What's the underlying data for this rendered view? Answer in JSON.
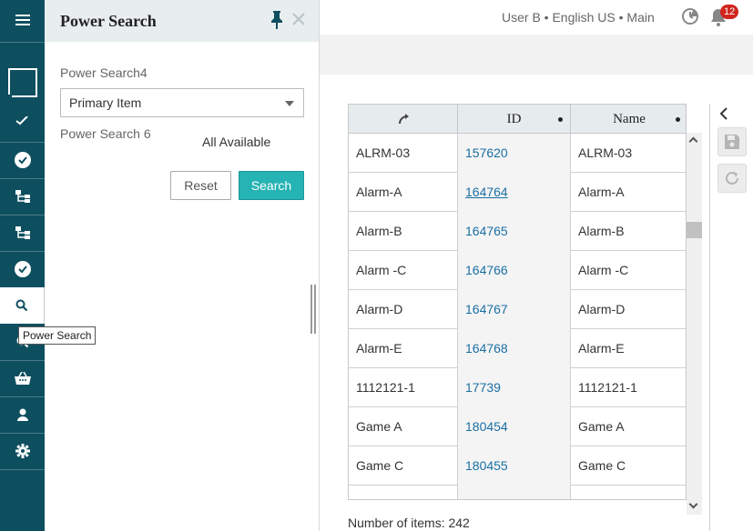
{
  "tooltip": "Power Search",
  "panel": {
    "title": "Power Search",
    "field1_label": "Power Search4",
    "select_value": "Primary Item",
    "field2_label": "Power Search 6",
    "field2_value": "All Available",
    "reset_label": "Reset",
    "search_label": "Search"
  },
  "header": {
    "user_line": "User B • English US • Main",
    "notification_count": "12"
  },
  "grid": {
    "columns": [
      "",
      "ID",
      "Name"
    ],
    "rows": [
      {
        "c1": "ALRM-03",
        "id": "157620",
        "name": "ALRM-03"
      },
      {
        "c1": "Alarm-A",
        "id": "164764",
        "name": "Alarm-A"
      },
      {
        "c1": "Alarm-B",
        "id": "164765",
        "name": "Alarm-B"
      },
      {
        "c1": "Alarm -C",
        "id": "164766",
        "name": "Alarm -C"
      },
      {
        "c1": "Alarm-D",
        "id": "164767",
        "name": "Alarm-D"
      },
      {
        "c1": "Alarm-E",
        "id": "164768",
        "name": "Alarm-E"
      },
      {
        "c1": "1112121-1",
        "id": "17739",
        "name": "1112121-1"
      },
      {
        "c1": "Game A",
        "id": "180454",
        "name": "Game A"
      },
      {
        "c1": "Game C",
        "id": "180455",
        "name": "Game C"
      },
      {
        "c1": "",
        "id": "",
        "name": ""
      }
    ]
  },
  "footer": {
    "count_text": "Number of items: 242"
  },
  "colors": {
    "rail": "#0e4f5f",
    "accent": "#26b3b4",
    "link": "#1a6fa3",
    "badge": "#d0251e"
  }
}
